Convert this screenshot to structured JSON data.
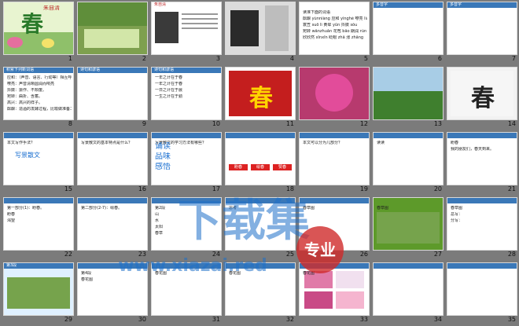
{
  "slides": [
    {
      "n": "1",
      "title": "朱自清",
      "big": "春"
    },
    {
      "n": "2"
    },
    {
      "n": "3",
      "title": "朱自清"
    },
    {
      "n": "4"
    },
    {
      "n": "5",
      "lines": [
        "读准下面的词语",
        "酝酿 yùnniàng 应和 yìnghè 嘹亮 liáo",
        "蓑笠 suō lì 黄晕 yūn 抖擞 sǒu",
        "宛转 wǎnzhuǎn 花苞 bāo 朗润 rùn",
        "欣欣然 xīnxīn 眨眼 zhǎ 涨 zhǎng"
      ]
    },
    {
      "n": "6",
      "title": "多音字"
    },
    {
      "n": "7",
      "title": "多音字"
    },
    {
      "n": "8",
      "title": "积累下列新词语",
      "lines": [
        "应和：（声音、语言、行动等）相互呼应。",
        "嘹亮：声音清晰圆润而响亮",
        "抖擞：振作、不颓废。",
        "宛转：曲折、含蓄。",
        "高兴：高兴的样子。",
        "酝酿：造酒的发酵过程，比喻做准备工作。"
      ]
    },
    {
      "n": "9",
      "title": "诗句和谚语"
    },
    {
      "n": "10",
      "title": "诗句和谚语",
      "lines": [
        "一年之计在于春",
        "一年之计在于春",
        "一日之计在于晨",
        "一生之计在于勤"
      ]
    },
    {
      "n": "11",
      "big": "春"
    },
    {
      "n": "12"
    },
    {
      "n": "13"
    },
    {
      "n": "14",
      "big": "春"
    },
    {
      "n": "15",
      "lines": [
        "本文写作手法？",
        "写景散文"
      ]
    },
    {
      "n": "16",
      "lines": [
        "写景散文的基本特点是什么？"
      ]
    },
    {
      "n": "17",
      "lines": [
        "写景散文的学习方法有哪些？",
        "诵读",
        "品味",
        "感悟"
      ]
    },
    {
      "n": "18",
      "lines": [
        "盼春",
        "绘春",
        "赞春"
      ]
    },
    {
      "n": "19",
      "lines": [
        "本文可以分为几部分？"
      ]
    },
    {
      "n": "20",
      "lines": [
        "读读"
      ]
    },
    {
      "n": "21",
      "lines": [
        "盼春",
        "我的朋友们，春天到来。"
      ]
    },
    {
      "n": "22",
      "lines": [
        "第一部分(1)：盼春。",
        "盼春",
        "渴望"
      ]
    },
    {
      "n": "23",
      "lines": [
        "第二部分(2-7)：绘春。"
      ]
    },
    {
      "n": "24",
      "lines": [
        "第2段",
        "山",
        "水",
        "太阳",
        "春草"
      ]
    },
    {
      "n": "25",
      "lines": [
        "思考"
      ]
    },
    {
      "n": "26",
      "lines": [
        "春草图"
      ]
    },
    {
      "n": "27",
      "lines": [
        "春草图"
      ]
    },
    {
      "n": "28",
      "lines": [
        "春草图",
        "总写：",
        "分写："
      ]
    },
    {
      "n": "29",
      "title": "第3段"
    },
    {
      "n": "30",
      "lines": [
        "第4段",
        "春花图"
      ]
    },
    {
      "n": "31",
      "lines": [
        "春花图"
      ]
    },
    {
      "n": "32",
      "lines": [
        "春花图"
      ]
    },
    {
      "n": "33",
      "lines": [
        "春花图"
      ]
    },
    {
      "n": "34"
    },
    {
      "n": "35"
    }
  ],
  "watermark": {
    "brand": "下载集",
    "site": "www.xiazai.red",
    "badge": "专业"
  }
}
